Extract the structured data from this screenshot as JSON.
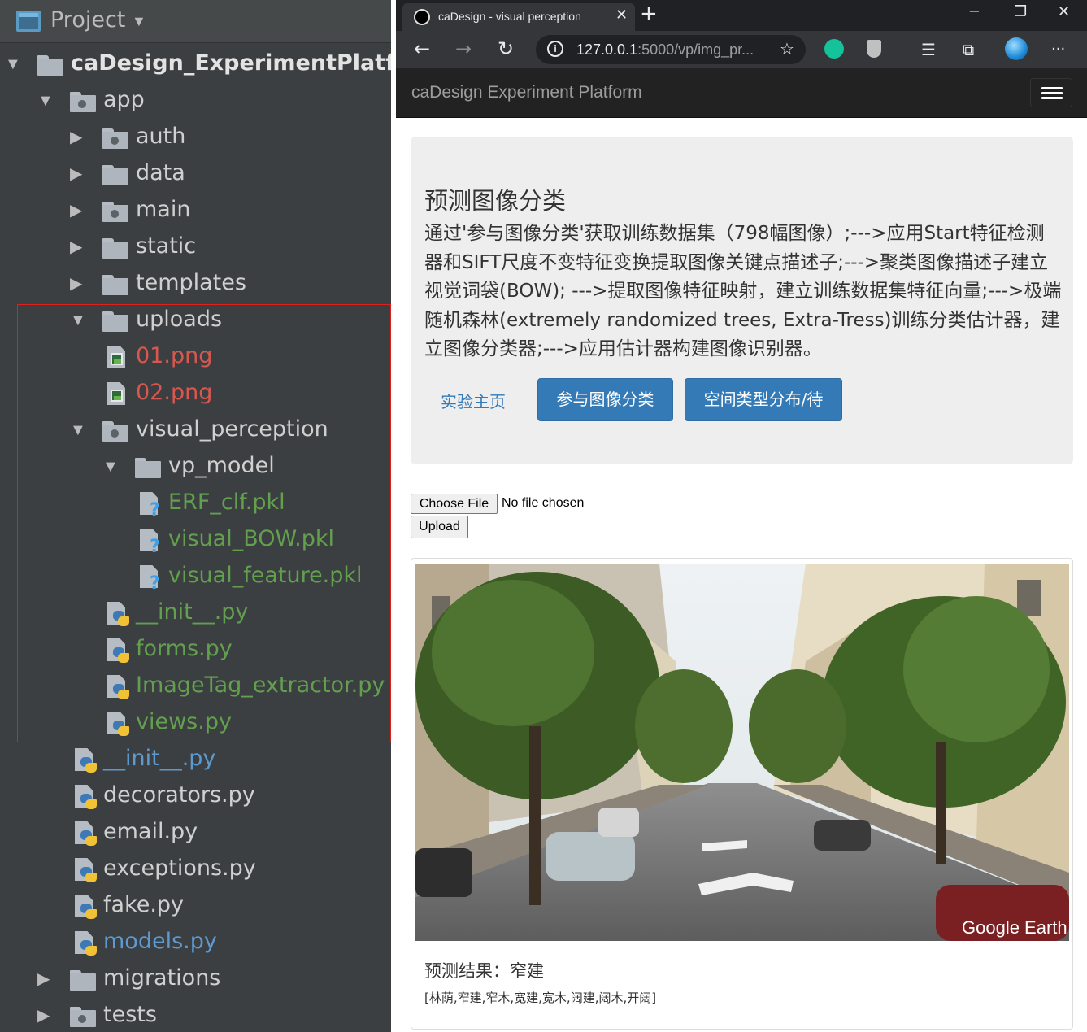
{
  "ide": {
    "panel_title": "Project",
    "tree": [
      {
        "label": "caDesign_ExperimentPlatform",
        "kind": "folder",
        "style": "root",
        "arrow": "▼"
      },
      {
        "label": "app",
        "kind": "package",
        "style": "normal",
        "arrow": "▼"
      },
      {
        "label": "auth",
        "kind": "package",
        "style": "normal",
        "arrow": "▶"
      },
      {
        "label": "data",
        "kind": "folder",
        "style": "normal",
        "arrow": "▶"
      },
      {
        "label": "main",
        "kind": "package",
        "style": "normal",
        "arrow": "▶"
      },
      {
        "label": "static",
        "kind": "folder",
        "style": "normal",
        "arrow": "▶"
      },
      {
        "label": "templates",
        "kind": "folder",
        "style": "normal",
        "arrow": "▶"
      },
      {
        "label": "uploads",
        "kind": "folder",
        "style": "normal",
        "arrow": "▼"
      },
      {
        "label": "01.png",
        "kind": "image",
        "style": "red",
        "arrow": ""
      },
      {
        "label": "02.png",
        "kind": "image",
        "style": "red",
        "arrow": ""
      },
      {
        "label": "visual_perception",
        "kind": "package",
        "style": "normal",
        "arrow": "▼"
      },
      {
        "label": "vp_model",
        "kind": "folder",
        "style": "normal",
        "arrow": "▼"
      },
      {
        "label": "ERF_clf.pkl",
        "kind": "unknown",
        "style": "green",
        "arrow": ""
      },
      {
        "label": "visual_BOW.pkl",
        "kind": "unknown",
        "style": "green",
        "arrow": ""
      },
      {
        "label": "visual_feature.pkl",
        "kind": "unknown",
        "style": "green",
        "arrow": ""
      },
      {
        "label": "__init__.py",
        "kind": "python",
        "style": "green",
        "arrow": ""
      },
      {
        "label": "forms.py",
        "kind": "python",
        "style": "green",
        "arrow": ""
      },
      {
        "label": "ImageTag_extractor.py",
        "kind": "python",
        "style": "green",
        "arrow": ""
      },
      {
        "label": "views.py",
        "kind": "python",
        "style": "green",
        "arrow": ""
      },
      {
        "label": "__init__.py",
        "kind": "python",
        "style": "blue",
        "arrow": ""
      },
      {
        "label": "decorators.py",
        "kind": "python",
        "style": "normal",
        "arrow": ""
      },
      {
        "label": "email.py",
        "kind": "python",
        "style": "normal",
        "arrow": ""
      },
      {
        "label": "exceptions.py",
        "kind": "python",
        "style": "normal",
        "arrow": ""
      },
      {
        "label": "fake.py",
        "kind": "python",
        "style": "normal",
        "arrow": ""
      },
      {
        "label": "models.py",
        "kind": "python",
        "style": "blue",
        "arrow": ""
      },
      {
        "label": "migrations",
        "kind": "folder",
        "style": "normal",
        "arrow": "▶"
      },
      {
        "label": "tests",
        "kind": "package",
        "style": "normal",
        "arrow": "▶"
      }
    ]
  },
  "browser": {
    "tab_title": "caDesign - visual perception",
    "url_host": "127.0.0.1",
    "url_rest": ":5000/vp/img_pr...",
    "icons": {
      "back": "←",
      "forward": "→",
      "reload": "↻",
      "star": "☆",
      "new_tab": "+",
      "tab_close": "✕",
      "minimize": "─",
      "restore": "❐",
      "close": "✕",
      "more": "···"
    },
    "colors": {
      "grammarly": "#15c39a",
      "shield": "#c0c0c0",
      "globe": "#1e8ad6"
    }
  },
  "app": {
    "brand": "caDesign Experiment Platform",
    "heading": "预测图像分类",
    "description": "通过'参与图像分类'获取训练数据集（798幅图像）;--->应用Start特征检测器和SIFT尺度不变特征变换提取图像关键点描述子;--->聚类图像描述子建立视觉词袋(BOW); --->提取图像特征映射，建立训练数据集特征向量;--->极端随机森林(extremely randomized trees, Extra-Tress)训练分类估计器，建立图像分类器;--->应用估计器构建图像识别器。",
    "link_home": "实验主页",
    "btn_classify": "参与图像分类",
    "btn_spatial": "空间类型分布/待",
    "choose_file": "Choose File",
    "no_file": "No file chosen",
    "upload": "Upload",
    "photo_watermark": "Google Earth",
    "prediction_title": "预测结果：窄建",
    "prediction_list": "[林荫,窄建,窄木,宽建,宽木,阔建,阔木,开阔]"
  }
}
